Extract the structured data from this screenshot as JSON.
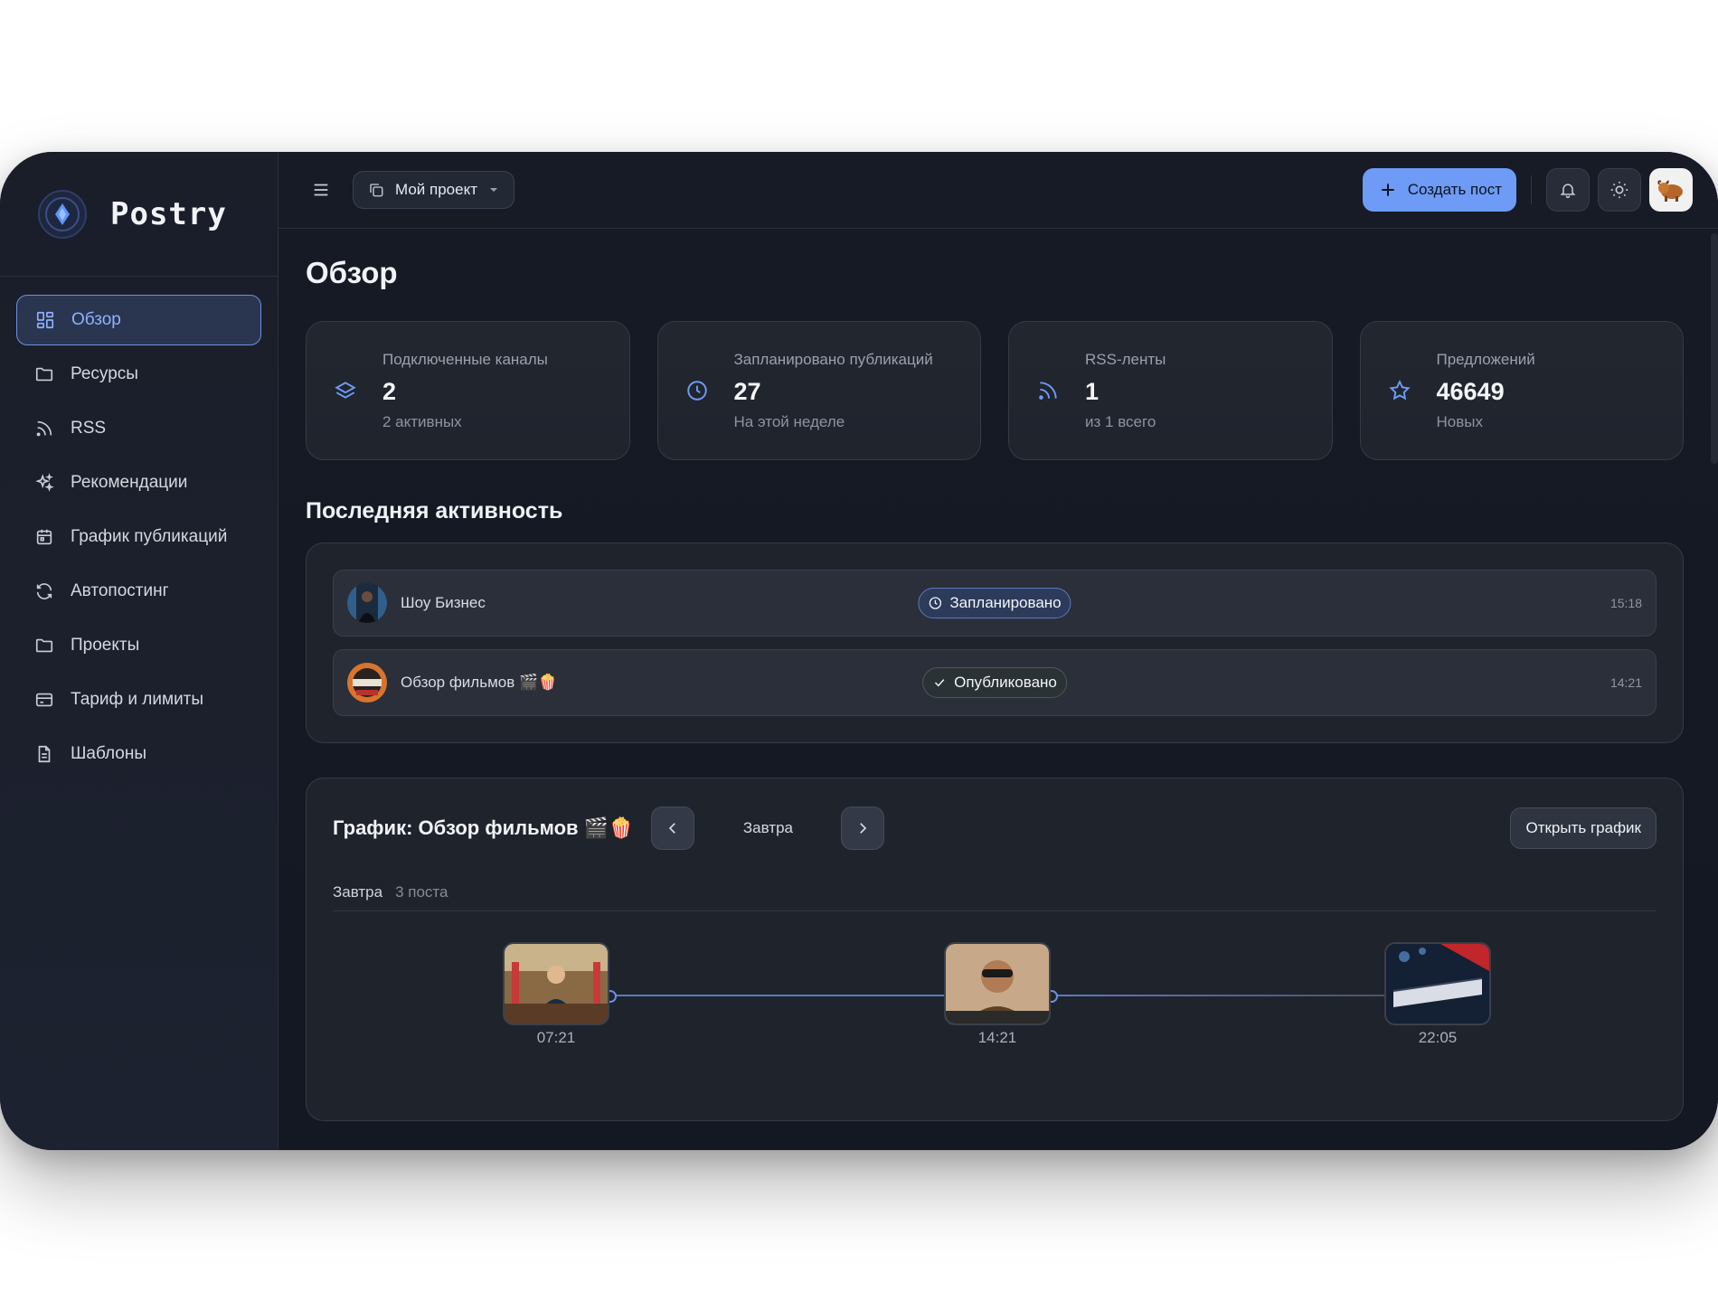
{
  "app": {
    "name": "Postry"
  },
  "sidebar": {
    "items": [
      {
        "label": "Обзор",
        "icon": "grid-icon",
        "active": true
      },
      {
        "label": "Ресурсы",
        "icon": "folder-icon"
      },
      {
        "label": "RSS",
        "icon": "rss-icon"
      },
      {
        "label": "Рекомендации",
        "icon": "sparkles-icon"
      },
      {
        "label": "График публикаций",
        "icon": "calendar-icon"
      },
      {
        "label": "Автопостинг",
        "icon": "refresh-icon"
      },
      {
        "label": "Проекты",
        "icon": "folder-icon"
      },
      {
        "label": "Тариф и лимиты",
        "icon": "credit-card-icon"
      },
      {
        "label": "Шаблоны",
        "icon": "document-icon"
      }
    ]
  },
  "topbar": {
    "project": "Мой проект",
    "create_label": "Создать пост"
  },
  "page": {
    "title": "Обзор"
  },
  "stats": [
    {
      "label": "Подключенные каналы",
      "value": "2",
      "sub": "2 активных",
      "icon": "layers-icon"
    },
    {
      "label": "Запланировано публикаций",
      "value": "27",
      "sub": "На этой неделе",
      "icon": "clock-icon"
    },
    {
      "label": "RSS-ленты",
      "value": "1",
      "sub": "из 1 всего",
      "icon": "rss-icon"
    },
    {
      "label": "Предложений",
      "value": "46649",
      "sub": "Новых",
      "icon": "star-icon"
    }
  ],
  "activity": {
    "title": "Последняя активность",
    "rows": [
      {
        "name": "Шоу Бизнес",
        "status": "Запланировано",
        "time": "15:18"
      },
      {
        "name": "Обзор фильмов 🎬🍿",
        "status": "Опубликовано",
        "time": "14:21"
      }
    ]
  },
  "schedule": {
    "title": "График: Обзор фильмов 🎬🍿",
    "day": "Завтра",
    "open_label": "Открыть график",
    "day_meta": "Завтра",
    "count": "3 поста",
    "posts": [
      {
        "time": "07:21"
      },
      {
        "time": "14:21"
      },
      {
        "time": "22:05"
      }
    ]
  },
  "colors": {
    "accent": "#6d9bf5",
    "background": "#141720",
    "card": "#20242d"
  }
}
